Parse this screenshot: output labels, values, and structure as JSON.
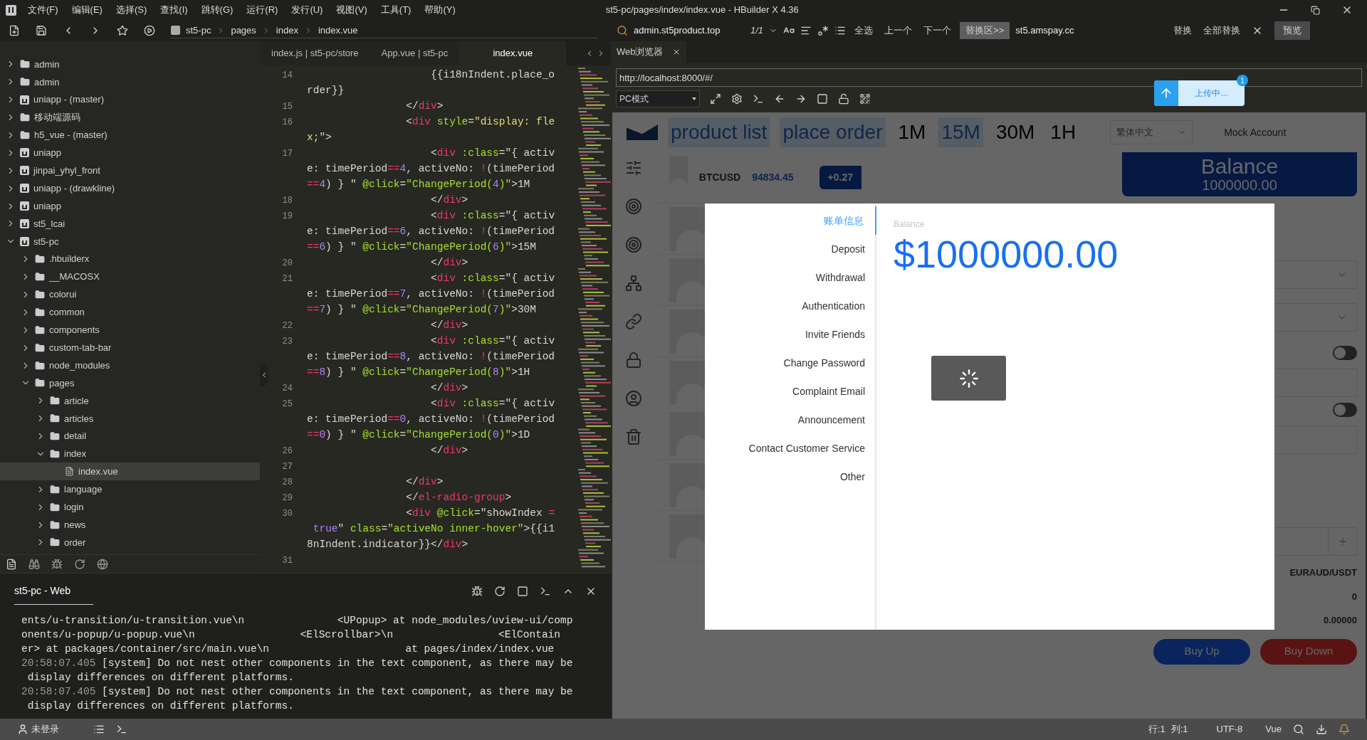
{
  "menu_bar": {
    "items": [
      "文件(F)",
      "编辑(E)",
      "选择(S)",
      "查找(I)",
      "跳转(G)",
      "运行(R)",
      "发行(U)",
      "视图(V)",
      "工具(T)",
      "帮助(Y)"
    ],
    "title": "st5-pc/pages/index/index.vue - HBuilder X 4.36"
  },
  "toolbar": {
    "breadcrumb": [
      "st5-pc",
      "pages",
      "index",
      "index.vue"
    ],
    "find_value": "admin.st5product.top",
    "match_count": "1/1",
    "find_actions": [
      "全选",
      "上一个",
      "下一个"
    ],
    "replace_toggle": "替换区>>",
    "replace_value": "st5.amspay.cc",
    "replace_actions": [
      "替换",
      "全部替换"
    ],
    "preview": "预览"
  },
  "sidebar": {
    "tree": [
      {
        "label": "admin",
        "kind": "folder",
        "expanded": false
      },
      {
        "label": "admin",
        "kind": "folder",
        "expanded": false
      },
      {
        "label": "uniapp - (master)",
        "kind": "project",
        "expanded": false
      },
      {
        "label": "移动端源码",
        "kind": "folder",
        "expanded": false
      },
      {
        "label": "h5_vue - (master)",
        "kind": "folder",
        "expanded": false
      },
      {
        "label": "uniapp",
        "kind": "project",
        "expanded": false
      },
      {
        "label": "jinpai_yhyl_front",
        "kind": "project",
        "expanded": false
      },
      {
        "label": "uniapp - (drawkline)",
        "kind": "project",
        "expanded": false
      },
      {
        "label": "uniapp",
        "kind": "project",
        "expanded": false
      },
      {
        "label": "st5_lcai",
        "kind": "project",
        "expanded": false
      },
      {
        "label": "st5-pc",
        "kind": "project",
        "expanded": true,
        "children": [
          {
            "label": ".hbuilderx",
            "kind": "folder",
            "expanded": false
          },
          {
            "label": "__MACOSX",
            "kind": "folder",
            "expanded": false
          },
          {
            "label": "colorui",
            "kind": "folder",
            "expanded": false
          },
          {
            "label": "common",
            "kind": "folder",
            "expanded": false
          },
          {
            "label": "components",
            "kind": "folder",
            "expanded": false
          },
          {
            "label": "custom-tab-bar",
            "kind": "folder",
            "expanded": false
          },
          {
            "label": "node_modules",
            "kind": "folder",
            "expanded": false
          },
          {
            "label": "pages",
            "kind": "folder",
            "expanded": true,
            "children": [
              {
                "label": "article",
                "kind": "folder",
                "expanded": false
              },
              {
                "label": "articles",
                "kind": "folder",
                "expanded": false
              },
              {
                "label": "detail",
                "kind": "folder",
                "expanded": false
              },
              {
                "label": "index",
                "kind": "folder",
                "expanded": true,
                "children": [
                  {
                    "label": "index.vue",
                    "kind": "file",
                    "selected": true
                  }
                ]
              },
              {
                "label": "language",
                "kind": "folder",
                "expanded": false
              },
              {
                "label": "login",
                "kind": "folder",
                "expanded": false
              },
              {
                "label": "news",
                "kind": "folder",
                "expanded": false
              },
              {
                "label": "order",
                "kind": "folder",
                "expanded": false
              }
            ]
          }
        ]
      }
    ]
  },
  "editor": {
    "tabs": [
      {
        "label": "index.js | st5-pc/store",
        "selected": false
      },
      {
        "label": "App.vue | st5-pc",
        "selected": false
      },
      {
        "label": "index.vue",
        "selected": true
      }
    ],
    "lines": [
      {
        "number": "14",
        "rows": [
          {
            "tokens": [
              {
                "kind": "plain",
                "text": "                    {{i18nIndent.place_o"
              }
            ]
          },
          {
            "tokens": [
              {
                "kind": "plain",
                "text": "rder}}"
              }
            ]
          }
        ]
      },
      {
        "number": "15",
        "rows": [
          {
            "tokens": [
              {
                "kind": "plain",
                "text": "                </"
              },
              {
                "kind": "tag",
                "text": "div"
              },
              {
                "kind": "plain",
                "text": ">"
              }
            ]
          }
        ]
      },
      {
        "number": "16",
        "rows": [
          {
            "tokens": [
              {
                "kind": "plain",
                "text": "                <"
              },
              {
                "kind": "tag",
                "text": "div"
              },
              {
                "kind": "attr",
                "text": " style"
              },
              {
                "kind": "plain",
                "text": "="
              },
              {
                "kind": "str",
                "text": "\"display: fle"
              }
            ]
          },
          {
            "tokens": [
              {
                "kind": "str",
                "text": "x;\""
              },
              {
                "kind": "plain",
                "text": ">"
              }
            ]
          }
        ]
      },
      {
        "number": "17",
        "rows": [
          {
            "tokens": [
              {
                "kind": "plain",
                "text": "                    <"
              },
              {
                "kind": "tag",
                "text": "div"
              },
              {
                "kind": "attr",
                "text": " :class"
              },
              {
                "kind": "plain",
                "text": "=\"{ activ"
              }
            ]
          },
          {
            "tokens": [
              {
                "kind": "plain",
                "text": "e: timePeriod"
              },
              {
                "kind": "op",
                "text": "=="
              },
              {
                "kind": "num",
                "text": "4"
              },
              {
                "kind": "plain",
                "text": ", activeNo: "
              },
              {
                "kind": "op",
                "text": "!"
              },
              {
                "kind": "plain",
                "text": "(timePeriod"
              }
            ]
          },
          {
            "tokens": [
              {
                "kind": "op",
                "text": "=="
              },
              {
                "kind": "num",
                "text": "4"
              },
              {
                "kind": "plain",
                "text": ") } \" "
              },
              {
                "kind": "attr",
                "text": "@click"
              },
              {
                "kind": "plain",
                "text": "="
              },
              {
                "kind": "fn",
                "text": "\"ChangePeriod("
              },
              {
                "kind": "num",
                "text": "4"
              },
              {
                "kind": "fn",
                "text": ")\""
              },
              {
                "kind": "plain",
                "text": ">1M"
              }
            ]
          }
        ]
      },
      {
        "number": "18",
        "rows": [
          {
            "tokens": [
              {
                "kind": "plain",
                "text": "                    </"
              },
              {
                "kind": "tag",
                "text": "div"
              },
              {
                "kind": "plain",
                "text": ">"
              }
            ]
          }
        ]
      },
      {
        "number": "19",
        "rows": [
          {
            "tokens": [
              {
                "kind": "plain",
                "text": "                    <"
              },
              {
                "kind": "tag",
                "text": "div"
              },
              {
                "kind": "attr",
                "text": " :class"
              },
              {
                "kind": "plain",
                "text": "=\"{ activ"
              }
            ]
          },
          {
            "tokens": [
              {
                "kind": "plain",
                "text": "e: timePeriod"
              },
              {
                "kind": "op",
                "text": "=="
              },
              {
                "kind": "num",
                "text": "6"
              },
              {
                "kind": "plain",
                "text": ", activeNo: "
              },
              {
                "kind": "op",
                "text": "!"
              },
              {
                "kind": "plain",
                "text": "(timePeriod"
              }
            ]
          },
          {
            "tokens": [
              {
                "kind": "op",
                "text": "=="
              },
              {
                "kind": "num",
                "text": "6"
              },
              {
                "kind": "plain",
                "text": ") } \" "
              },
              {
                "kind": "attr",
                "text": "@click"
              },
              {
                "kind": "plain",
                "text": "="
              },
              {
                "kind": "fn",
                "text": "\"ChangePeriod("
              },
              {
                "kind": "num",
                "text": "6"
              },
              {
                "kind": "fn",
                "text": ")\""
              },
              {
                "kind": "plain",
                "text": ">15M"
              }
            ]
          }
        ]
      },
      {
        "number": "20",
        "rows": [
          {
            "tokens": [
              {
                "kind": "plain",
                "text": "                    </"
              },
              {
                "kind": "tag",
                "text": "div"
              },
              {
                "kind": "plain",
                "text": ">"
              }
            ]
          }
        ]
      },
      {
        "number": "21",
        "rows": [
          {
            "tokens": [
              {
                "kind": "plain",
                "text": "                    <"
              },
              {
                "kind": "tag",
                "text": "div"
              },
              {
                "kind": "attr",
                "text": " :class"
              },
              {
                "kind": "plain",
                "text": "=\"{ activ"
              }
            ]
          },
          {
            "tokens": [
              {
                "kind": "plain",
                "text": "e: timePeriod"
              },
              {
                "kind": "op",
                "text": "=="
              },
              {
                "kind": "num",
                "text": "7"
              },
              {
                "kind": "plain",
                "text": ", activeNo: "
              },
              {
                "kind": "op",
                "text": "!"
              },
              {
                "kind": "plain",
                "text": "(timePeriod"
              }
            ]
          },
          {
            "tokens": [
              {
                "kind": "op",
                "text": "=="
              },
              {
                "kind": "num",
                "text": "7"
              },
              {
                "kind": "plain",
                "text": ") } \" "
              },
              {
                "kind": "attr",
                "text": "@click"
              },
              {
                "kind": "plain",
                "text": "="
              },
              {
                "kind": "fn",
                "text": "\"ChangePeriod("
              },
              {
                "kind": "num",
                "text": "7"
              },
              {
                "kind": "fn",
                "text": ")\""
              },
              {
                "kind": "plain",
                "text": ">30M"
              }
            ]
          }
        ]
      },
      {
        "number": "22",
        "rows": [
          {
            "tokens": [
              {
                "kind": "plain",
                "text": "                    </"
              },
              {
                "kind": "tag",
                "text": "div"
              },
              {
                "kind": "plain",
                "text": ">"
              }
            ]
          }
        ]
      },
      {
        "number": "23",
        "rows": [
          {
            "tokens": [
              {
                "kind": "plain",
                "text": "                    <"
              },
              {
                "kind": "tag",
                "text": "div"
              },
              {
                "kind": "attr",
                "text": " :class"
              },
              {
                "kind": "plain",
                "text": "=\"{ activ"
              }
            ]
          },
          {
            "tokens": [
              {
                "kind": "plain",
                "text": "e: timePeriod"
              },
              {
                "kind": "op",
                "text": "=="
              },
              {
                "kind": "num",
                "text": "8"
              },
              {
                "kind": "plain",
                "text": ", activeNo: "
              },
              {
                "kind": "op",
                "text": "!"
              },
              {
                "kind": "plain",
                "text": "(timePeriod"
              }
            ]
          },
          {
            "tokens": [
              {
                "kind": "op",
                "text": "=="
              },
              {
                "kind": "num",
                "text": "8"
              },
              {
                "kind": "plain",
                "text": ") } \" "
              },
              {
                "kind": "attr",
                "text": "@click"
              },
              {
                "kind": "plain",
                "text": "="
              },
              {
                "kind": "fn",
                "text": "\"ChangePeriod("
              },
              {
                "kind": "num",
                "text": "8"
              },
              {
                "kind": "fn",
                "text": ")\""
              },
              {
                "kind": "plain",
                "text": ">1H"
              }
            ]
          }
        ]
      },
      {
        "number": "24",
        "rows": [
          {
            "tokens": [
              {
                "kind": "plain",
                "text": "                    </"
              },
              {
                "kind": "tag",
                "text": "div"
              },
              {
                "kind": "plain",
                "text": ">"
              }
            ]
          }
        ]
      },
      {
        "number": "25",
        "rows": [
          {
            "tokens": [
              {
                "kind": "plain",
                "text": "                    <"
              },
              {
                "kind": "tag",
                "text": "div"
              },
              {
                "kind": "attr",
                "text": " :class"
              },
              {
                "kind": "plain",
                "text": "=\"{ activ"
              }
            ]
          },
          {
            "tokens": [
              {
                "kind": "plain",
                "text": "e: timePeriod"
              },
              {
                "kind": "op",
                "text": "=="
              },
              {
                "kind": "num",
                "text": "0"
              },
              {
                "kind": "plain",
                "text": ", activeNo: "
              },
              {
                "kind": "op",
                "text": "!"
              },
              {
                "kind": "plain",
                "text": "(timePeriod"
              }
            ]
          },
          {
            "tokens": [
              {
                "kind": "op",
                "text": "=="
              },
              {
                "kind": "num",
                "text": "0"
              },
              {
                "kind": "plain",
                "text": ") } \" "
              },
              {
                "kind": "attr",
                "text": "@click"
              },
              {
                "kind": "plain",
                "text": "="
              },
              {
                "kind": "fn",
                "text": "\"ChangePeriod("
              },
              {
                "kind": "num",
                "text": "0"
              },
              {
                "kind": "fn",
                "text": ")\""
              },
              {
                "kind": "plain",
                "text": ">1D"
              }
            ]
          }
        ]
      },
      {
        "number": "26",
        "rows": [
          {
            "tokens": [
              {
                "kind": "plain",
                "text": "                    </"
              },
              {
                "kind": "tag",
                "text": "div"
              },
              {
                "kind": "plain",
                "text": ">"
              }
            ]
          }
        ]
      },
      {
        "number": "27",
        "rows": [
          {
            "tokens": []
          }
        ]
      },
      {
        "number": "28",
        "rows": [
          {
            "tokens": [
              {
                "kind": "plain",
                "text": "                </"
              },
              {
                "kind": "tag",
                "text": "div"
              },
              {
                "kind": "plain",
                "text": ">"
              }
            ]
          }
        ]
      },
      {
        "number": "29",
        "rows": [
          {
            "tokens": [
              {
                "kind": "plain",
                "text": "                </"
              },
              {
                "kind": "tag",
                "text": "el-radio-group"
              },
              {
                "kind": "plain",
                "text": ">"
              }
            ]
          }
        ]
      },
      {
        "number": "30",
        "rows": [
          {
            "tokens": [
              {
                "kind": "plain",
                "text": "                <"
              },
              {
                "kind": "tag",
                "text": "div"
              },
              {
                "kind": "attr",
                "text": " @click"
              },
              {
                "kind": "plain",
                "text": "=\"showIndex "
              },
              {
                "kind": "op",
                "text": "="
              }
            ]
          },
          {
            "tokens": [
              {
                "kind": "num",
                "text": " true"
              },
              {
                "kind": "plain",
                "text": "\" "
              },
              {
                "kind": "attr",
                "text": "class"
              },
              {
                "kind": "plain",
                "text": "="
              },
              {
                "kind": "fn",
                "text": "\"activeNo inner-hover\""
              },
              {
                "kind": "plain",
                "text": ">{{i1"
              }
            ]
          },
          {
            "tokens": [
              {
                "kind": "plain",
                "text": "8nIndent.indicator}}</"
              },
              {
                "kind": "tag",
                "text": "div"
              },
              {
                "kind": "plain",
                "text": ">"
              }
            ]
          }
        ]
      },
      {
        "number": "31",
        "rows": [
          {
            "tokens": []
          }
        ]
      }
    ]
  },
  "console": {
    "tab": "st5-pc - Web",
    "rows": [
      {
        "text": "ents/u-transition/u-transition.vue\\n               <UPopup> at node_modules/uview-ui/comp"
      },
      {
        "text": "onents/u-popup/u-popup.vue\\n                 <ElScrollbar>\\n                 <ElContain"
      },
      {
        "text": "er> at packages/container/src/main.vue\\n                      at pages/index/index.vue"
      },
      {
        "time": "20:58:07.405",
        "text": " [system] Do not nest other components in the text component, as there may be"
      },
      {
        "text": " display differences on different platforms."
      },
      {
        "time": "20:58:07.405",
        "text": " [system] Do not nest other components in the text component, as there may be"
      },
      {
        "text": " display differences on different platforms."
      }
    ]
  },
  "browser": {
    "tab": "Web浏览器",
    "url": "http://localhost:8000/#/",
    "mode": "PC模式",
    "upload": {
      "label": "上传中...",
      "badge": "1"
    },
    "page": {
      "nav": [
        {
          "label": "product list",
          "selected": true
        },
        {
          "label": "place order",
          "selected": true
        }
      ],
      "periods": [
        {
          "label": "1M",
          "selected": false
        },
        {
          "label": "15M",
          "selected": true
        },
        {
          "label": "30M",
          "selected": false
        },
        {
          "label": "1H",
          "selected": false
        }
      ],
      "language": "繁体中文",
      "account": "Mock Account",
      "balance_card": {
        "title": "Balance",
        "amount": "1000000.00"
      },
      "product": {
        "symbol": "BTCUSD",
        "price": "94834.45",
        "change": "+0.27"
      },
      "toggles": [
        {
          "on": false
        },
        {
          "on": false
        }
      ],
      "pair": "EURAUD/USDT",
      "value_1": "0",
      "value_2": "0.00000",
      "buttons": [
        "Buy Up",
        "Buy Down"
      ]
    },
    "dialog": {
      "menu": [
        {
          "label": "账单信息",
          "selected": true
        },
        {
          "label": "Deposit",
          "selected": false
        },
        {
          "label": "Withdrawal",
          "selected": false
        },
        {
          "label": "Authentication",
          "selected": false
        },
        {
          "label": "Invite Friends",
          "selected": false
        },
        {
          "label": "Change Password",
          "selected": false
        },
        {
          "label": "Complaint Email",
          "selected": false
        },
        {
          "label": "Announcement",
          "selected": false
        },
        {
          "label": "Contact Customer Service",
          "selected": false
        },
        {
          "label": "Other",
          "selected": false
        }
      ],
      "balance_label": "Balance",
      "balance": "$1000000.00",
      "loading": true
    }
  },
  "status_bar": {
    "user": "未登录",
    "line": "行:1",
    "column": "列:1",
    "encoding": "UTF-8",
    "language": "Vue"
  }
}
